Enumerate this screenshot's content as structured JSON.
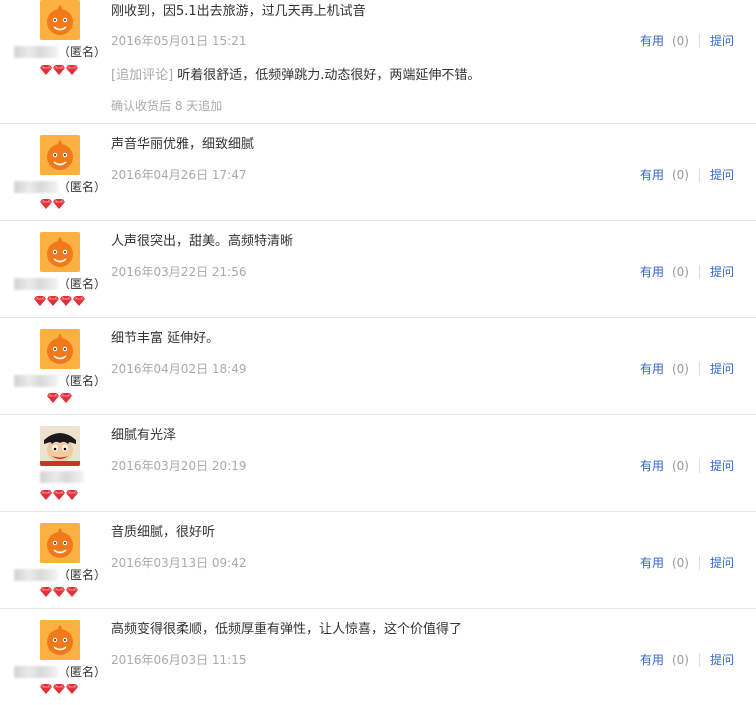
{
  "reviews": [
    {
      "text": "刚收到，因5.1出去旅游，过几天再上机试音",
      "date": "2016年05月01日 15:21",
      "anon": "（匿名）",
      "gems": 3,
      "avatar": "orange",
      "append_tag": "[追加评论]",
      "append_text": " 听着很舒适，低频弹跳力.动态很好，两端延伸不错。",
      "append_note": "确认收货后 8 天追加"
    },
    {
      "text": "声音华丽优雅，细致细腻",
      "date": "2016年04月26日 17:47",
      "anon": "（匿名）",
      "gems": 2,
      "avatar": "orange"
    },
    {
      "text": "人声很突出，甜美。高频特清晰",
      "date": "2016年03月22日 21:56",
      "anon": "（匿名）",
      "gems": 4,
      "avatar": "orange"
    },
    {
      "text": "细节丰富 延伸好。",
      "date": "2016年04月02日 18:49",
      "anon": "（匿名）",
      "gems": 2,
      "avatar": "orange"
    },
    {
      "text": "细腻有光泽",
      "date": "2016年03月20日 20:19",
      "anon": "",
      "gems": 3,
      "avatar": "luffy"
    },
    {
      "text": "音质细腻，很好听",
      "date": "2016年03月13日 09:42",
      "anon": "（匿名）",
      "gems": 3,
      "avatar": "orange"
    },
    {
      "text": "高频变得很柔顺，低频厚重有弹性，让人惊喜，这个价值得了",
      "date": "2016年06月03日 11:15",
      "anon": "（匿名）",
      "gems": 3,
      "avatar": "orange"
    }
  ],
  "actions": {
    "useful_label": "有用",
    "count": "(0)",
    "ask_label": "提问"
  },
  "colors": {
    "link": "#3366cc",
    "meta": "#aaaaaa",
    "divider": "#e6e6e6",
    "gem": "#e0303a"
  }
}
